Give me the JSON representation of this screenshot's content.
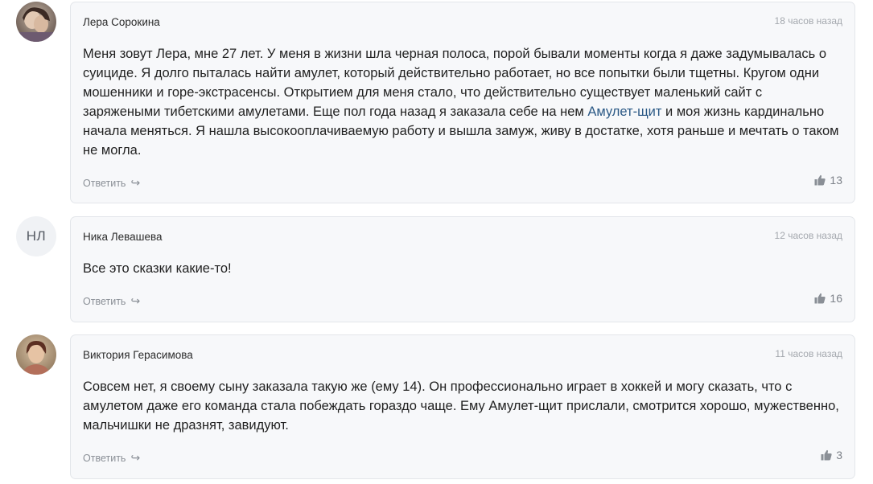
{
  "comments": [
    {
      "author": "Лера Сорокина",
      "time": "18 часов назад",
      "text_before": "Меня зовут Лера, мне 27 лет. У меня в жизни шла черная полоса, порой бывали моменты когда я даже задумывалась о суициде. Я долго пыталась найти амулет, который действительно работает, но все попытки были тщетны. Кругом одни мошенники и горе-экстрасенсы. Открытием для меня стало, что действительно существует маленький сайт с заряжеными тибетскими амулетами. Еще пол года назад я заказала себе на нем ",
      "link": "Амулет-щит",
      "text_after": " и моя жизнь кардинально начала меняться. Я нашла высокооплачиваемую работу и вышла замуж, живу в достатке, хотя раньше и мечтать о таком не могла.",
      "reply_label": "Ответить",
      "likes": "13",
      "avatar_type": "photo"
    },
    {
      "author": "Ника Левашева",
      "time": "12 часов назад",
      "initials": "НЛ",
      "text": "Все это сказки какие-то!",
      "reply_label": "Ответить",
      "likes": "16",
      "avatar_type": "initials"
    },
    {
      "author": "Виктория Герасимова",
      "time": "11 часов назад",
      "text": "Совсем нет, я своему сыну заказала такую же (ему 14). Он профессионально играет в хоккей и могу сказать, что с амулетом даже его команда стала побеждать гораздо чаще. Ему Амулет-щит прислали, смотрится хорошо, мужественно, мальчишки не дразнят, завидуют.",
      "reply_label": "Ответить",
      "likes": "3",
      "avatar_type": "photo"
    }
  ],
  "icons": {
    "reply": "reply-arrow-icon",
    "like": "thumbs-up-icon"
  },
  "colors": {
    "link": "#2a5885",
    "card_bg": "#f7f8fa",
    "muted": "#8a8f96"
  }
}
